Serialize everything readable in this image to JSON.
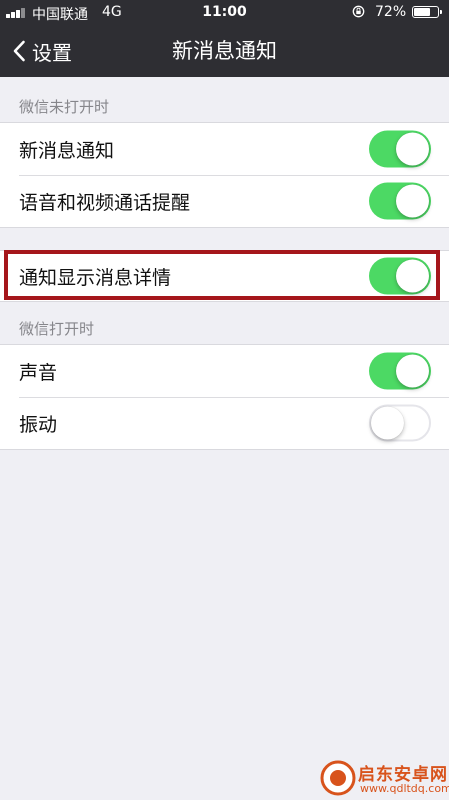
{
  "status_bar": {
    "carrier": "中国联通",
    "network": "4G",
    "time": "11:00",
    "battery_percent_text": "72%",
    "battery_level": 0.72
  },
  "nav": {
    "back_label": "设置",
    "title": "新消息通知"
  },
  "sections": [
    {
      "header": "微信未打开时",
      "rows": [
        {
          "label": "新消息通知",
          "on": true
        },
        {
          "label": "语音和视频通话提醒",
          "on": true
        }
      ]
    },
    {
      "header": "",
      "rows": [
        {
          "label": "通知显示消息详情",
          "on": true
        }
      ]
    },
    {
      "header": "微信打开时",
      "rows": [
        {
          "label": "声音",
          "on": true
        },
        {
          "label": "振动",
          "on": false
        }
      ]
    }
  ],
  "colors": {
    "toggle_on": "#4cd964",
    "header_bg": "#2e2e33",
    "highlight": "#a5161b"
  },
  "watermark": {
    "name": "启东安卓网",
    "url": "www.qdltdq.com"
  }
}
